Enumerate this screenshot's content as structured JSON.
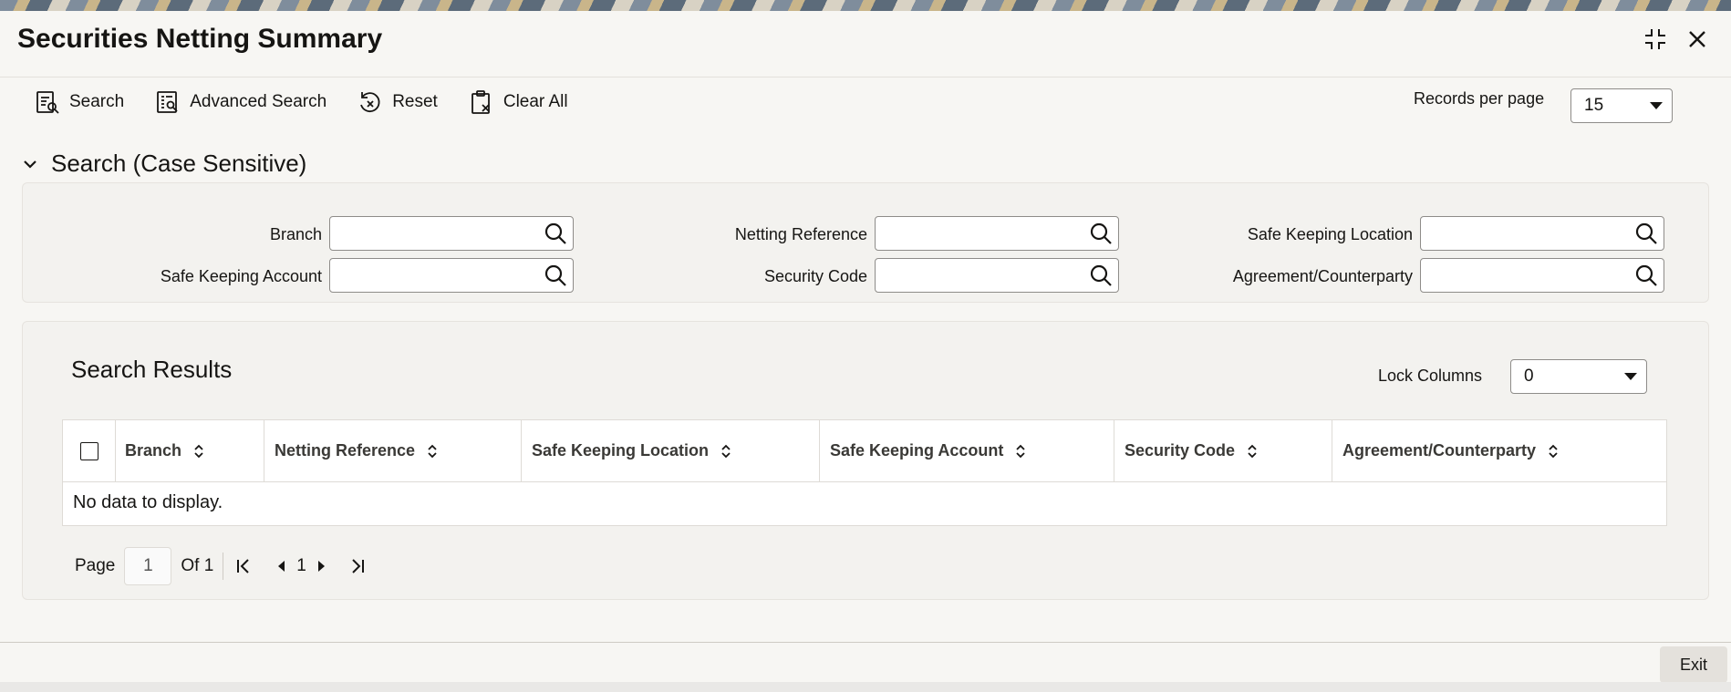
{
  "window": {
    "title": "Securities Netting Summary",
    "icons": [
      "minimize-icon",
      "close-icon"
    ]
  },
  "toolbar": {
    "search_label": "Search",
    "advanced_search_label": "Advanced Search",
    "reset_label": "Reset",
    "clear_all_label": "Clear All",
    "records_per_page_label": "Records per page",
    "records_per_page_value": "15"
  },
  "search": {
    "section_title": "Search (Case Sensitive)",
    "fields": {
      "branch": "Branch",
      "netting_reference": "Netting Reference",
      "safe_keeping_location": "Safe Keeping Location",
      "safe_keeping_account": "Safe Keeping Account",
      "security_code": "Security Code",
      "agreement_counterparty": "Agreement/Counterparty"
    }
  },
  "results": {
    "title": "Search Results",
    "lock_columns_label": "Lock Columns",
    "lock_columns_value": "0",
    "columns": [
      "Branch",
      "Netting Reference",
      "Safe Keeping Location",
      "Safe Keeping Account",
      "Security Code",
      "Agreement/Counterparty"
    ],
    "empty_message": "No data to display."
  },
  "pager": {
    "page_label": "Page",
    "current_page": "1",
    "of_label": "Of 1",
    "page_number": "1"
  },
  "footer": {
    "exit_label": "Exit"
  }
}
